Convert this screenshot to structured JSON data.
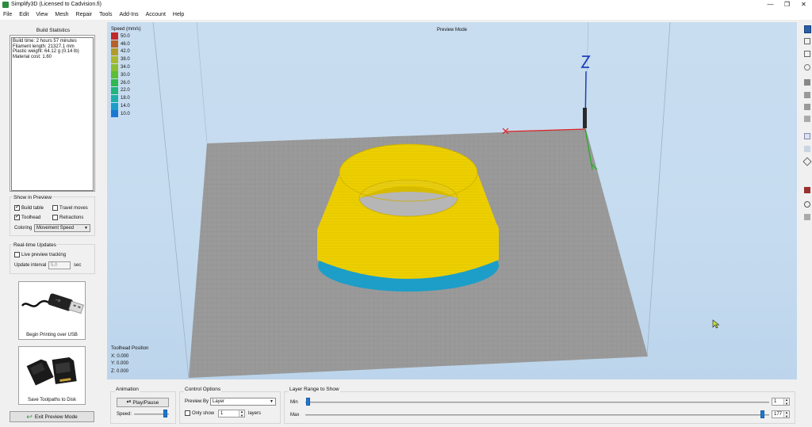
{
  "window": {
    "title": "Simplify3D (Licensed to Cadvision.fi)",
    "minimize": "—",
    "restore": "❐",
    "close": "✕"
  },
  "menu": [
    "File",
    "Edit",
    "View",
    "Mesh",
    "Repair",
    "Tools",
    "Add-Ins",
    "Account",
    "Help"
  ],
  "build_stats": {
    "title": "Build Statistics",
    "lines": [
      "Build time: 2 hours 57 minutes",
      "Filament length: 21327.1 mm",
      "Plastic weight: 64.12 g (0.14 lb)",
      "Material cost: 1.60"
    ]
  },
  "show_in_preview": {
    "title": "Show in Preview",
    "build_table": {
      "label": "Build table",
      "checked": true
    },
    "travel_moves": {
      "label": "Travel moves",
      "checked": false
    },
    "toolhead": {
      "label": "Toolhead",
      "checked": true
    },
    "retractions": {
      "label": "Retractions",
      "checked": false
    },
    "coloring_label": "Coloring",
    "coloring_value": "Movement Speed"
  },
  "realtime": {
    "title": "Real-time Updates",
    "live_label": "Live preview tracking",
    "interval_label": "Update interval",
    "interval_value": "5,0",
    "interval_unit": "sec"
  },
  "usb_button": {
    "label": "Begin Printing over USB"
  },
  "sd_button": {
    "label": "Save Toolpaths to Disk"
  },
  "exit_button": {
    "label": "Exit Preview Mode"
  },
  "viewport": {
    "title": "Preview Mode",
    "legend_title": "Speed (mm/s)",
    "legend": [
      {
        "value": "50.0",
        "color": "#c0282a"
      },
      {
        "value": "46.0",
        "color": "#b8602a"
      },
      {
        "value": "42.0",
        "color": "#b29a2c"
      },
      {
        "value": "38.0",
        "color": "#aab82e"
      },
      {
        "value": "34.0",
        "color": "#8cbf30"
      },
      {
        "value": "30.0",
        "color": "#5cbd36"
      },
      {
        "value": "26.0",
        "color": "#2fb84e"
      },
      {
        "value": "22.0",
        "color": "#22b47c"
      },
      {
        "value": "18.0",
        "color": "#1eb0a6"
      },
      {
        "value": "14.0",
        "color": "#1c9ec8"
      },
      {
        "value": "10.0",
        "color": "#1a78d2"
      }
    ],
    "toolhead_title": "Toolhead Position",
    "x": "X: 0.000",
    "y": "Y: 0.000",
    "z": "Z: 0.000"
  },
  "animation": {
    "title": "Animation",
    "play_label": "Play/Pause",
    "speed_label": "Speed:",
    "speed_level": 0.9
  },
  "control": {
    "title": "Control Options",
    "preview_by_label": "Preview By",
    "preview_by_value": "Layer",
    "only_show_label": "Only show",
    "only_show_value": "1",
    "layers_label": "layers"
  },
  "layer_range": {
    "title": "Layer Range to Show",
    "min_label": "Min",
    "max_label": "Max",
    "min_value": "1",
    "max_value": "177"
  },
  "colors": {
    "accent": "#1e78d2",
    "model": "#f2d400",
    "base_edge": "#1c9ec8"
  }
}
